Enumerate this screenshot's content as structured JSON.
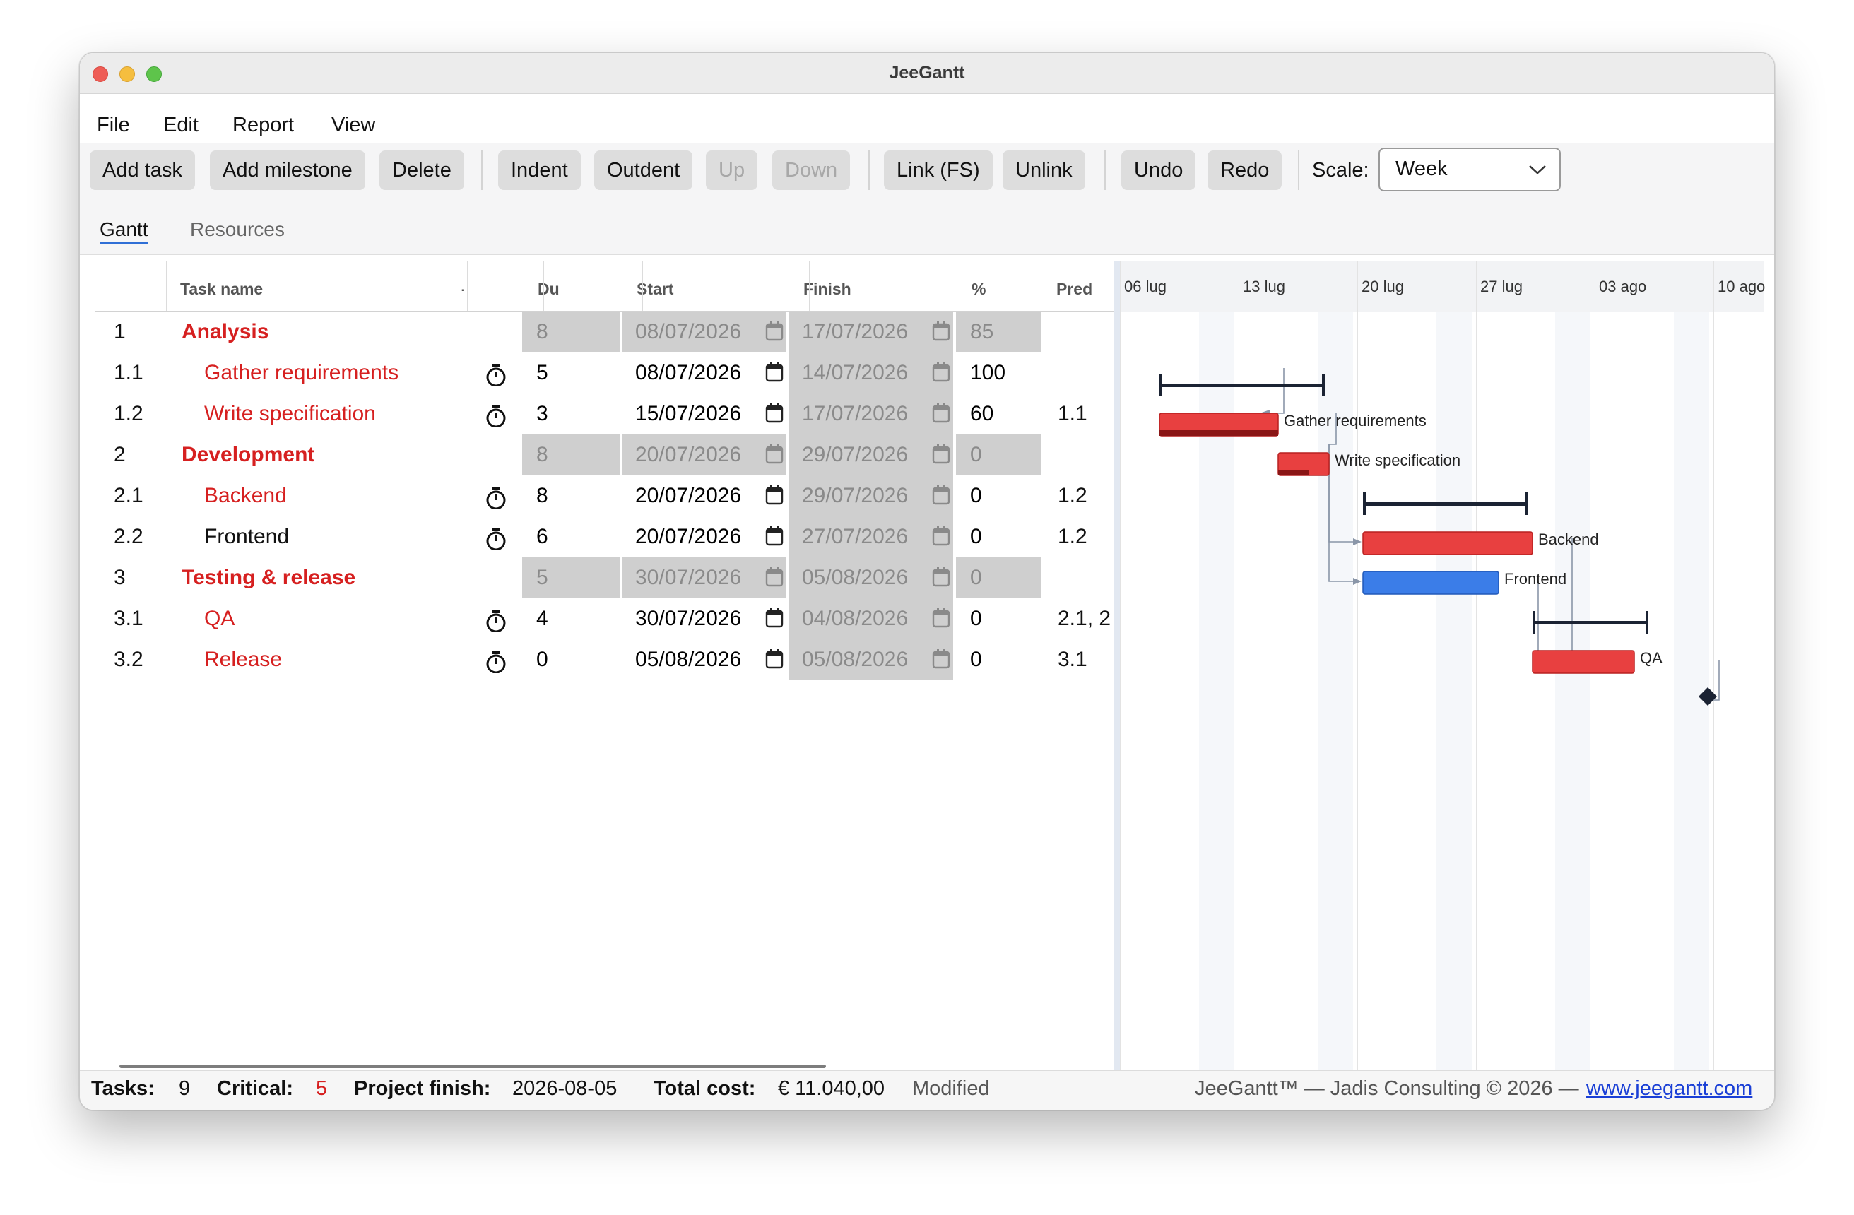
{
  "window": {
    "title": "JeeGantt"
  },
  "menu": [
    "File",
    "Edit",
    "Report",
    "View"
  ],
  "toolbar": {
    "add_task": "Add task",
    "add_milestone": "Add milestone",
    "delete": "Delete",
    "indent": "Indent",
    "outdent": "Outdent",
    "up": "Up",
    "down": "Down",
    "link": "Link (FS)",
    "unlink": "Unlink",
    "undo": "Undo",
    "redo": "Redo",
    "scale_label": "Scale:",
    "scale_value": "Week",
    "disabled": [
      "Up",
      "Down"
    ]
  },
  "tabs": {
    "gantt": "Gantt",
    "resources": "Resources",
    "active": "Gantt"
  },
  "grid": {
    "headers": {
      "num": "",
      "name": "Task name",
      "mode": "·",
      "duration": "Du",
      "start": "Start",
      "finish": "Finish",
      "percent": "%",
      "pred": "Pred"
    },
    "rows": [
      {
        "id": "1",
        "name": "Analysis",
        "summary": true,
        "critical": true,
        "duration": "8",
        "start": "08/07/2026",
        "finish": "17/07/2026",
        "percent": "85",
        "pred": ""
      },
      {
        "id": "1.1",
        "name": "Gather requirements",
        "summary": false,
        "critical": true,
        "duration": "5",
        "start": "08/07/2026",
        "finish": "14/07/2026",
        "percent": "100",
        "pred": ""
      },
      {
        "id": "1.2",
        "name": "Write specification",
        "summary": false,
        "critical": true,
        "duration": "3",
        "start": "15/07/2026",
        "finish": "17/07/2026",
        "percent": "60",
        "pred": "1.1"
      },
      {
        "id": "2",
        "name": "Development",
        "summary": true,
        "critical": true,
        "duration": "8",
        "start": "20/07/2026",
        "finish": "29/07/2026",
        "percent": "0",
        "pred": ""
      },
      {
        "id": "2.1",
        "name": "Backend",
        "summary": false,
        "critical": true,
        "duration": "8",
        "start": "20/07/2026",
        "finish": "29/07/2026",
        "percent": "0",
        "pred": "1.2"
      },
      {
        "id": "2.2",
        "name": "Frontend",
        "summary": false,
        "critical": false,
        "duration": "6",
        "start": "20/07/2026",
        "finish": "27/07/2026",
        "percent": "0",
        "pred": "1.2"
      },
      {
        "id": "3",
        "name": "Testing & release",
        "summary": true,
        "critical": true,
        "duration": "5",
        "start": "30/07/2026",
        "finish": "05/08/2026",
        "percent": "0",
        "pred": ""
      },
      {
        "id": "3.1",
        "name": "QA",
        "summary": false,
        "critical": true,
        "duration": "4",
        "start": "30/07/2026",
        "finish": "04/08/2026",
        "percent": "0",
        "pred": "2.1, 2"
      },
      {
        "id": "3.2",
        "name": "Release",
        "summary": false,
        "critical": true,
        "duration": "0",
        "start": "05/08/2026",
        "finish": "05/08/2026",
        "percent": "0",
        "pred": "3.1"
      }
    ]
  },
  "chart": {
    "week_labels": [
      "06 lug",
      "13 lug",
      "20 lug",
      "27 lug",
      "03 ago",
      "10 ago"
    ],
    "bar_labels": {
      "gather": "Gather requirements",
      "write": "Write specification",
      "backend": "Backend",
      "frontend": "Frontend",
      "qa": "QA"
    },
    "colors": {
      "critical": "#e84040",
      "normal": "#3b7de8",
      "summary": "#1b2333"
    }
  },
  "status": {
    "tasks_label": "Tasks:",
    "tasks_value": "9",
    "critical_label": "Critical:",
    "critical_value": "5",
    "finish_label": "Project finish:",
    "finish_value": "2026-08-05",
    "cost_label": "Total cost:",
    "cost_value": "€ 11.040,00",
    "modified": "Modified",
    "credits": "JeeGantt™ — Jadis Consulting © 2026 —",
    "link": "www.jeegantt.com"
  }
}
